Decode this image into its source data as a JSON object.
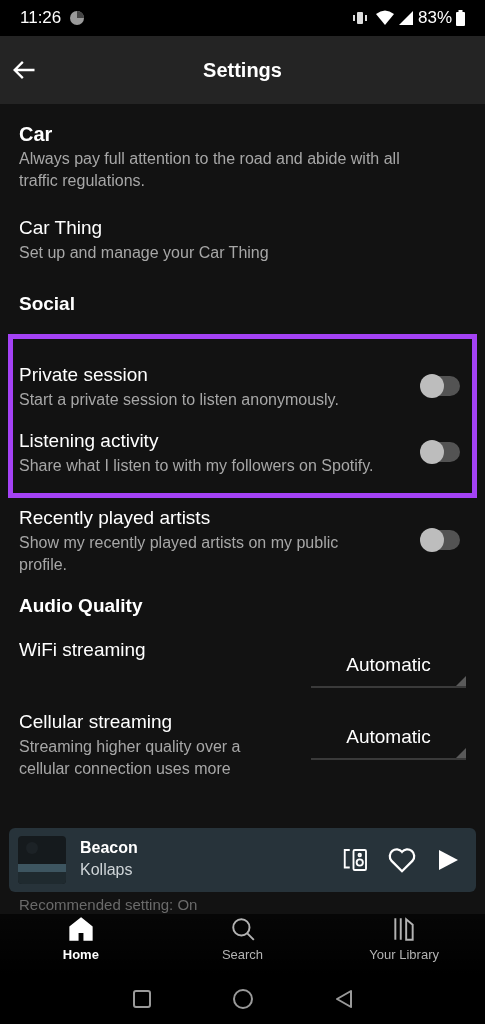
{
  "status_bar": {
    "time": "11:26",
    "battery": "83%"
  },
  "header": {
    "title": "Settings"
  },
  "blocks": [
    {
      "kind": "heading",
      "title": "Car",
      "description": "Always pay full attention to the road and abide with all traffic regulations."
    },
    {
      "kind": "link",
      "title": "Car Thing",
      "description": "Set up and manage your Car Thing"
    },
    {
      "kind": "section",
      "title": "Social"
    },
    {
      "kind": "highlight",
      "items": [
        {
          "kind": "toggle",
          "title": "Private session",
          "description": "Start a private session to listen anonymously.",
          "on": false
        },
        {
          "kind": "toggle",
          "title": "Listening activity",
          "description": "Share what I listen to with my followers on Spotify.",
          "on": false
        }
      ]
    },
    {
      "kind": "toggle",
      "title": "Recently played artists",
      "description": "Show my recently played artists on my public profile.",
      "on": false
    },
    {
      "kind": "section",
      "title": "Audio Quality"
    },
    {
      "kind": "dropdown",
      "title": "WiFi streaming",
      "value": "Automatic"
    },
    {
      "kind": "dropdown",
      "title": "Cellular streaming",
      "description": "Streaming higher quality over a cellular connection uses more",
      "value": "Automatic"
    },
    {
      "kind": "note",
      "title": "Recommended setting: On"
    }
  ],
  "mini_player": {
    "title": "Beacon",
    "artist": "Kollaps"
  },
  "nav": [
    {
      "label": "Home",
      "selected": true
    },
    {
      "label": "Search",
      "selected": false
    },
    {
      "label": "Your Library",
      "selected": false
    }
  ]
}
